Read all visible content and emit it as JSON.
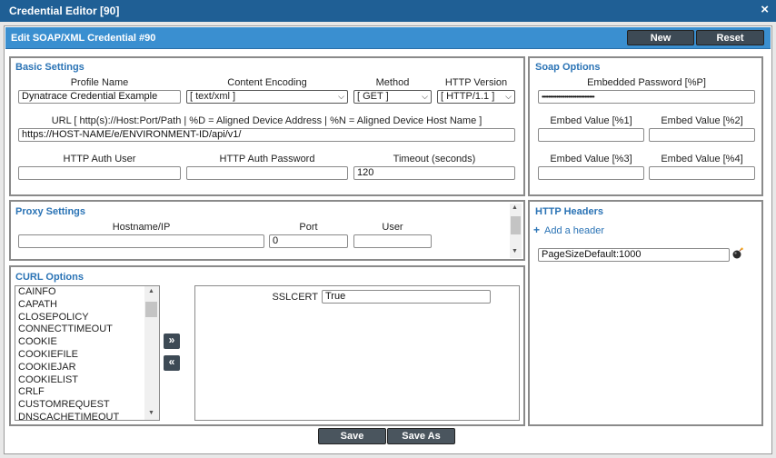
{
  "window": {
    "title": "Credential Editor [90]"
  },
  "header": {
    "title": "Edit SOAP/XML Credential #90",
    "new_label": "New",
    "reset_label": "Reset"
  },
  "basic": {
    "title": "Basic Settings",
    "profile_name_label": "Profile Name",
    "profile_name_value": "Dynatrace Credential Example",
    "content_encoding_label": "Content Encoding",
    "content_encoding_value": "[ text/xml ]",
    "method_label": "Method",
    "method_value": "[ GET ]",
    "http_version_label": "HTTP Version",
    "http_version_value": "[ HTTP/1.1 ]",
    "url_label": "URL [ http(s)://Host:Port/Path | %D = Aligned Device Address | %N = Aligned Device Host Name ]",
    "url_value": "https://HOST-NAME/e/ENVIRONMENT-ID/api/v1/",
    "auth_user_label": "HTTP Auth User",
    "auth_user_value": "",
    "auth_password_label": "HTTP Auth Password",
    "auth_password_value": "",
    "timeout_label": "Timeout (seconds)",
    "timeout_value": "120"
  },
  "soap": {
    "title": "Soap Options",
    "embedded_password_label": "Embedded Password [%P]",
    "embedded_password_value": "••••••••••••••••••••••••••••••••",
    "embed1_label": "Embed Value [%1]",
    "embed2_label": "Embed Value [%2]",
    "embed3_label": "Embed Value [%3]",
    "embed4_label": "Embed Value [%4]"
  },
  "proxy": {
    "title": "Proxy Settings",
    "hostname_label": "Hostname/IP",
    "hostname_value": "",
    "port_label": "Port",
    "port_value": "0",
    "user_label": "User",
    "user_value": ""
  },
  "headers": {
    "title": "HTTP Headers",
    "add_label": "Add a header",
    "add_glyph": "+",
    "items": [
      "PageSizeDefault:1000"
    ]
  },
  "curl": {
    "title": "CURL Options",
    "options": [
      "CAINFO",
      "CAPATH",
      "CLOSEPOLICY",
      "CONNECTTIMEOUT",
      "COOKIE",
      "COOKIEFILE",
      "COOKIEJAR",
      "COOKIELIST",
      "CRLF",
      "CUSTOMREQUEST",
      "DNSCACHETIMEOUT"
    ],
    "add_glyph": "»",
    "remove_glyph": "«",
    "sslcert_label": "SSLCERT",
    "sslcert_value": "True"
  },
  "footer": {
    "save_label": "Save",
    "save_as_label": "Save As"
  },
  "icons": {
    "close": "×",
    "chevron_down": "⌄",
    "up_arrow": "▲",
    "down_arrow": "▼",
    "delete_header": "bomb-icon"
  },
  "colors": {
    "titlebar": "#1f5f95",
    "header_bar": "#3a8fd0",
    "section_title": "#2a73b5",
    "button": "#3d4a55"
  }
}
